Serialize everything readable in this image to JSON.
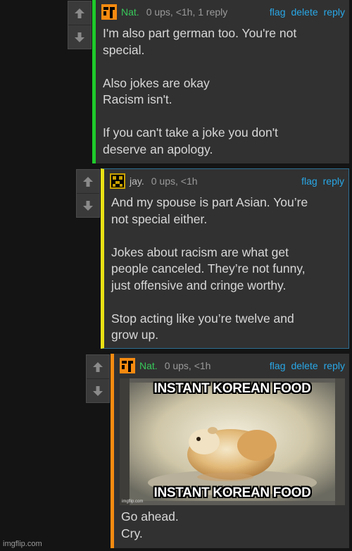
{
  "comments": [
    {
      "username": "Nat.",
      "meta": "0 ups, <1h, 1 reply",
      "actions": [
        "flag",
        "delete",
        "reply"
      ],
      "body": "I'm also part german too. You're not\nspecial.\n\nAlso jokes are okay\nRacism isn't.\n\nIf you can't take a joke you don't\ndeserve an apology."
    },
    {
      "username": "jay.",
      "meta": "0 ups, <1h",
      "actions": [
        "flag",
        "reply"
      ],
      "body": "And my spouse is part Asian. You’re\nnot special either.\n\nJokes about racism are what get\npeople canceled. They’re not funny,\njust offensive and cringe worthy.\n\nStop acting like you’re twelve and\ngrow up."
    },
    {
      "username": "Nat.",
      "meta": "0 ups, <1h",
      "actions": [
        "flag",
        "delete",
        "reply"
      ],
      "meme": {
        "top_text": "INSTANT KOREAN FOOD",
        "bottom_text": "INSTANT KOREAN FOOD",
        "watermark": "imgflip.com"
      },
      "body": "Go ahead.\nCry."
    }
  ],
  "footer_watermark": "imgflip.com",
  "colors": {
    "level1_bar": "#1fca2b",
    "level2_bar": "#e9e214",
    "level3_bar": "#f58a10",
    "link": "#29a7e6"
  }
}
